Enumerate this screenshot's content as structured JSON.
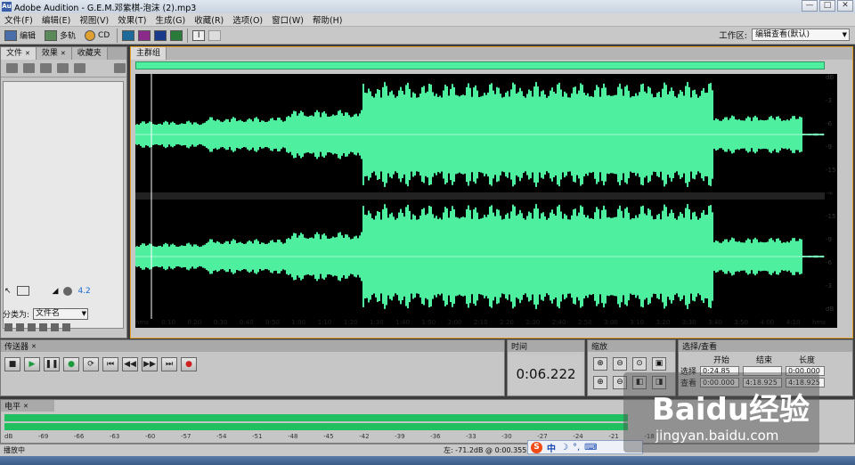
{
  "window": {
    "title": "Adobe Audition - G.E.M.邓紫棋-泡沫 (2).mp3",
    "app_icon": "Au"
  },
  "menu": [
    "文件(F)",
    "编辑(E)",
    "视图(V)",
    "效果(T)",
    "生成(G)",
    "收藏(R)",
    "选项(O)",
    "窗口(W)",
    "帮助(H)"
  ],
  "toolbar": {
    "edit": "编辑",
    "multitrack": "多轨",
    "cd": "CD",
    "workspace_label": "工作区:",
    "workspace_value": "编辑查看(默认)"
  },
  "left_panel": {
    "tabs": [
      "文件",
      "效果",
      "收藏夹"
    ],
    "classify_label": "分类为:",
    "classify_value": "文件名",
    "volume_value": "4.2"
  },
  "main_panel": {
    "tab": "主群组"
  },
  "db_scale": [
    "dB",
    "-3",
    "-6",
    "-9",
    "-15",
    "-∞",
    "-15",
    "-9",
    "-6",
    "-3",
    "dB"
  ],
  "timeline": [
    "hms",
    "0:10",
    "0:20",
    "0:30",
    "0:40",
    "0:50",
    "1:00",
    "1:10",
    "1:20",
    "1:30",
    "1:40",
    "1:50",
    "2:00",
    "2:10",
    "2:20",
    "2:30",
    "2:40",
    "2:50",
    "3:00",
    "3:10",
    "3:20",
    "3:30",
    "3:40",
    "3:50",
    "4:00",
    "4:10",
    "hms"
  ],
  "transport": {
    "title": "传送器"
  },
  "time_panel": {
    "title": "时间",
    "value": "0:06.222"
  },
  "zoom_panel": {
    "title": "缩放"
  },
  "selection": {
    "title": "选择/查看",
    "headers": [
      "开始",
      "结束",
      "长度"
    ],
    "rows": [
      {
        "label": "选择",
        "start": "0:24.85",
        "end": "",
        "length": "0:00.000"
      },
      {
        "label": "查看",
        "start": "0:00.000",
        "end": "4:18.925",
        "length": "4:18.925"
      }
    ]
  },
  "level": {
    "title": "电平",
    "scale": [
      "dB",
      "-69",
      "-66",
      "-63",
      "-60",
      "-57",
      "-54",
      "-51",
      "-48",
      "-45",
      "-42",
      "-39",
      "-36",
      "-33",
      "-30",
      "-27",
      "-24",
      "-21",
      "-18"
    ]
  },
  "status": {
    "left": "播放中",
    "info": "左: -71.2dB @  0:00.355",
    "rate": "4410"
  },
  "watermark": {
    "brand": "Baidu经验",
    "url": "jingyan.baidu.com"
  },
  "ime": {
    "label": "中"
  },
  "colors": {
    "wave": "#4ef0a0",
    "accent": "#e8a02a",
    "meter": "#20c060"
  }
}
